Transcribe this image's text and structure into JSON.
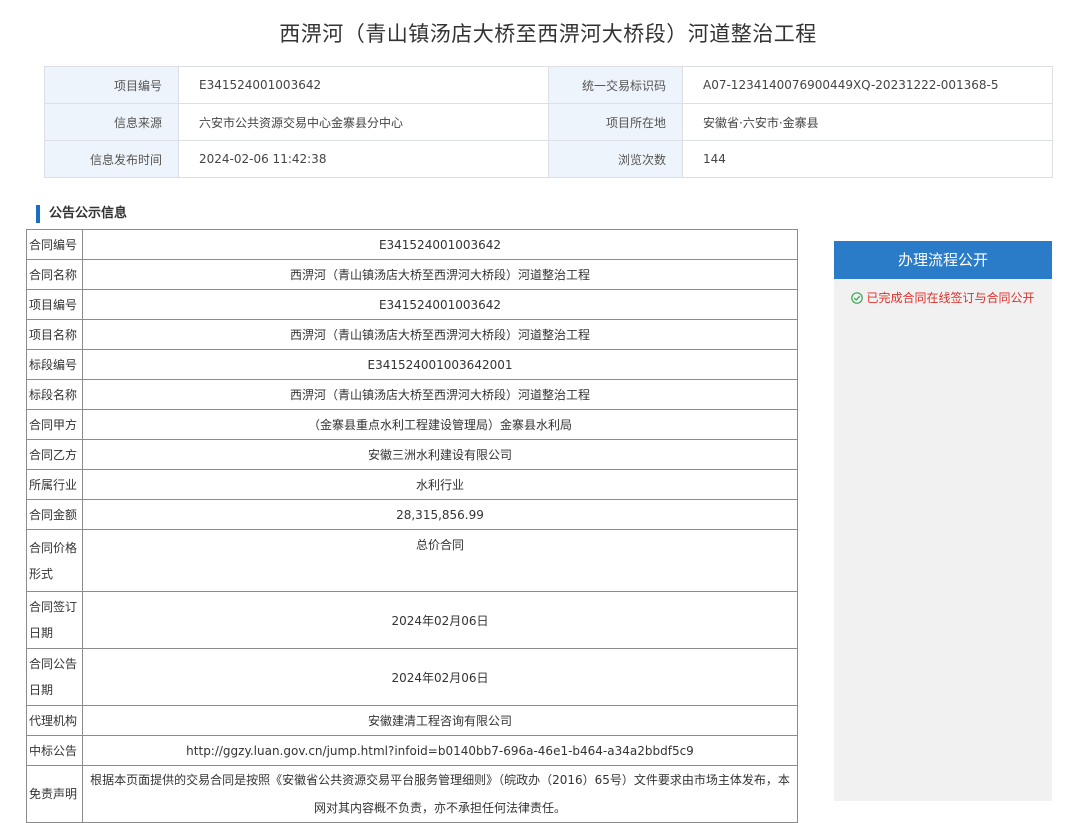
{
  "page": {
    "title": "西淠河（青山镇汤店大桥至西淠河大桥段）河道整治工程"
  },
  "info": {
    "rows": [
      {
        "k1": "项目编号",
        "v1": "E341524001003642",
        "k2": "统一交易标识码",
        "v2": "A07-1234140076900449XQ-20231222-001368-5"
      },
      {
        "k1": "信息来源",
        "v1": "六安市公共资源交易中心金寨县分中心",
        "k2": "项目所在地",
        "v2": "安徽省·六安市·金寨县"
      },
      {
        "k1": "信息发布时间",
        "v1": "2024-02-06 11:42:38",
        "k2": "浏览次数",
        "v2": "144"
      }
    ]
  },
  "section": {
    "title": "公告公示信息"
  },
  "notice": {
    "rows": [
      {
        "k": "合同编号",
        "v": "E341524001003642"
      },
      {
        "k": "合同名称",
        "v": "西淠河（青山镇汤店大桥至西淠河大桥段）河道整治工程"
      },
      {
        "k": "项目编号",
        "v": "E341524001003642"
      },
      {
        "k": "项目名称",
        "v": "西淠河（青山镇汤店大桥至西淠河大桥段）河道整治工程"
      },
      {
        "k": "标段编号",
        "v": "E341524001003642001"
      },
      {
        "k": "标段名称",
        "v": "西淠河（青山镇汤店大桥至西淠河大桥段）河道整治工程"
      },
      {
        "k": "合同甲方",
        "v": "（金寨县重点水利工程建设管理局）金寨县水利局"
      },
      {
        "k": "合同乙方",
        "v": "安徽三洲水利建设有限公司"
      },
      {
        "k": "所属行业",
        "v": "水利行业"
      },
      {
        "k": "合同金额",
        "v": "28,315,856.99"
      },
      {
        "k": "合同价格形式",
        "v": "总价合同"
      },
      {
        "k": "合同签订日期",
        "v": "2024年02月06日"
      },
      {
        "k": "合同公告日期",
        "v": "2024年02月06日"
      },
      {
        "k": "代理机构",
        "v": "安徽建清工程咨询有限公司"
      },
      {
        "k": "中标公告",
        "v": "http://ggzy.luan.gov.cn/jump.html?infoid=b0140bb7-696a-46e1-b464-a34a2bbdf5c9"
      },
      {
        "k": "免责声明",
        "v": "根据本页面提供的交易合同是按照《安徽省公共资源交易平台服务管理细则》（皖政办（2016）65号）文件要求由市场主体发布，本网对其内容概不负责，亦不承担任何法律责任。"
      }
    ]
  },
  "process": {
    "title": "办理流程公开",
    "step": "已完成合同在线签订与合同公开",
    "step_icon": "check-circle-icon",
    "accent_color": "#2a7bc8",
    "step_color": "#e0302a"
  }
}
